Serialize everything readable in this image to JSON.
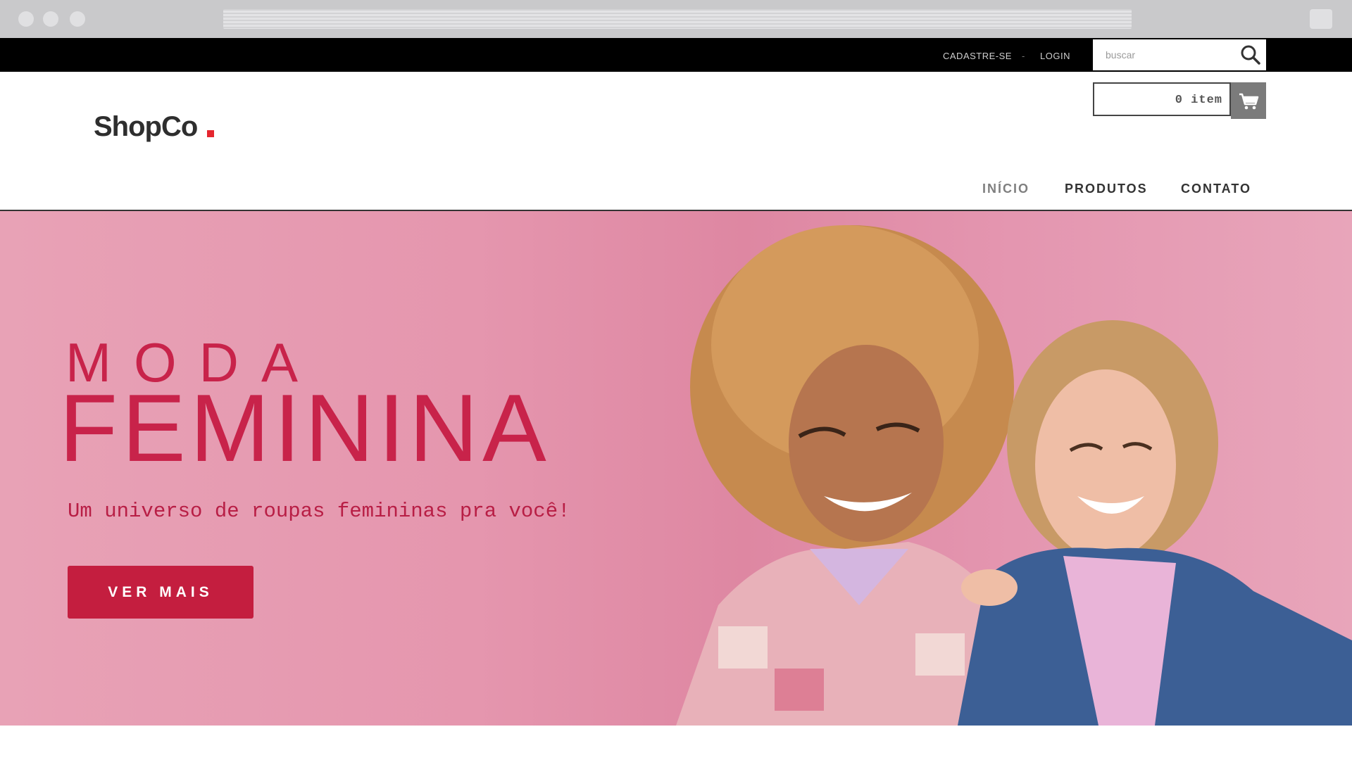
{
  "topbar": {
    "signup_label": "CADASTRE-SE",
    "separator": "-",
    "login_label": "LOGIN",
    "search": {
      "placeholder": "buscar",
      "value": "",
      "icon": "search-icon"
    }
  },
  "header": {
    "logo_text": "ShopCo",
    "logo_dot_color": "#e5262f",
    "cart": {
      "count_label": "0 item",
      "icon": "cart-icon"
    },
    "nav": [
      {
        "label": "INÍCIO",
        "active": true
      },
      {
        "label": "PRODUTOS",
        "active": false
      },
      {
        "label": "CONTATO",
        "active": false
      }
    ]
  },
  "hero": {
    "kicker": "MODA",
    "title": "FEMININA",
    "subtitle": "Um universo de roupas femininas pra você!",
    "cta_label": "VER MAIS",
    "accent_color": "#c8234a",
    "background_color": "#e596ae"
  }
}
